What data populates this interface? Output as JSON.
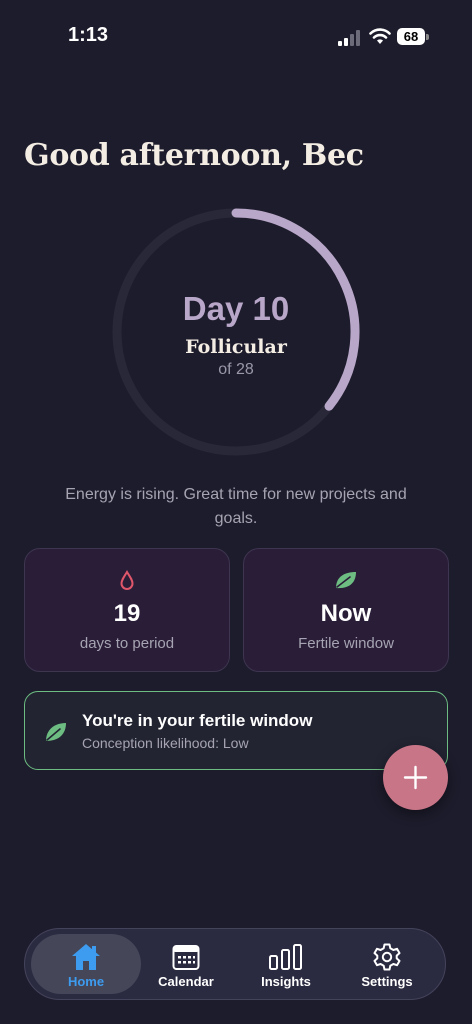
{
  "status_bar": {
    "time": "1:13",
    "battery": "68"
  },
  "greeting": "Good afternoon, Bec",
  "cycle": {
    "day_label": "Day 10",
    "phase": "Follicular",
    "length_label": "of 28",
    "day": 10,
    "length": 28
  },
  "phase_message": "Energy is rising. Great time for new projects and goals.",
  "cards": {
    "period": {
      "value": "19",
      "label": "days to period",
      "icon": "drop-icon"
    },
    "fertile": {
      "value": "Now",
      "label": "Fertile window",
      "icon": "leaf-icon"
    }
  },
  "banner": {
    "title": "You're in your fertile window",
    "subtitle": "Conception likelihood: Low",
    "icon": "leaf-icon"
  },
  "fab": {
    "icon": "plus-icon"
  },
  "tabs": [
    {
      "label": "Home",
      "icon": "home-icon",
      "active": true
    },
    {
      "label": "Calendar",
      "icon": "calendar-icon",
      "active": false
    },
    {
      "label": "Insights",
      "icon": "bar-chart-icon",
      "active": false
    },
    {
      "label": "Settings",
      "icon": "gear-icon",
      "active": false
    }
  ],
  "colors": {
    "background": "#1d1c2c",
    "accent_ring": "#b9a7c9",
    "fertile_green": "#6dbd82",
    "period_red": "#e0566a",
    "fab": "#c87587",
    "active_tab": "#3d9cf0"
  }
}
